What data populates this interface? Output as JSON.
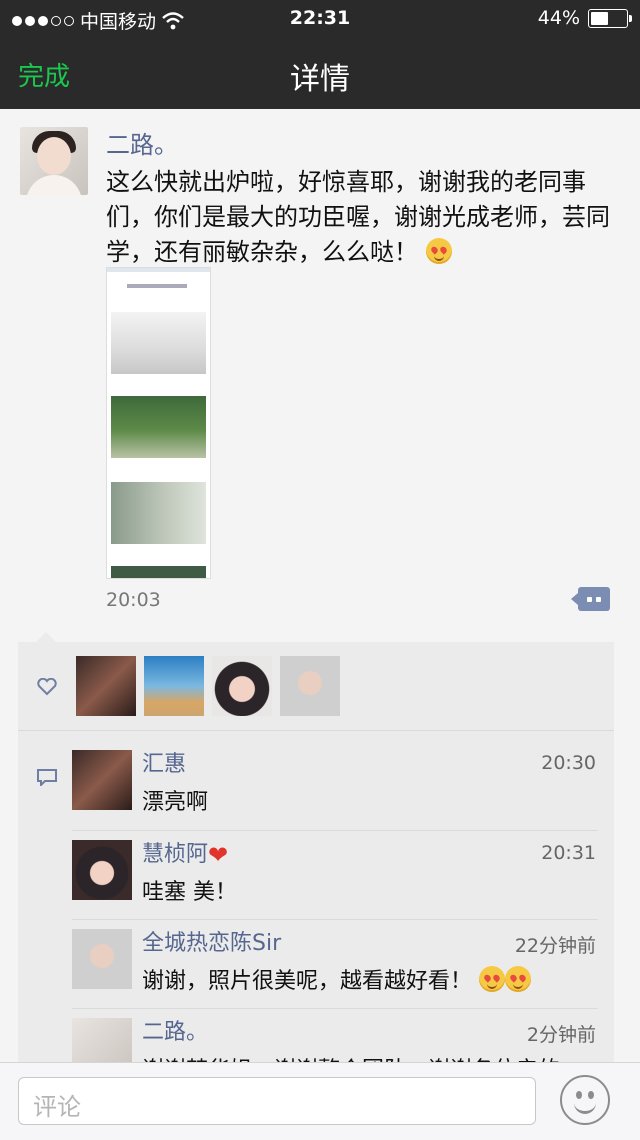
{
  "status": {
    "carrier": "中国移动",
    "time": "22:31",
    "battery": "44%",
    "battery_level": 0.44,
    "signal_bars_filled": 3,
    "signal_bars_total": 5
  },
  "nav": {
    "done_label": "完成",
    "title": "详情"
  },
  "post": {
    "author": "二路。",
    "text": "这么快就出炉啦，好惊喜耶，谢谢我的老同事们，你们是最大的功臣喔，谢谢光成老师，芸同学，还有丽敏杂杂，么么哒！",
    "time": "20:03"
  },
  "likes": {
    "count": 4
  },
  "comments": [
    {
      "name": "汇惠",
      "time": "20:30",
      "text": "漂亮啊"
    },
    {
      "name": "慧桢阿",
      "time": "20:31",
      "text": "哇塞  美！"
    },
    {
      "name": "全城热恋陈Sir",
      "time": "22分钟前",
      "text": "谢谢，照片很美呢，越看越好看！"
    },
    {
      "name": "二路。",
      "time": "2分钟前",
      "text": "谢谢梦华姐，谢谢整个团队，谢谢各位亲的"
    }
  ],
  "input": {
    "placeholder": "评论"
  },
  "colors": {
    "accent_green": "#1cc74f",
    "name_blue": "#56678f",
    "nav_bg": "#2a2a2a"
  }
}
